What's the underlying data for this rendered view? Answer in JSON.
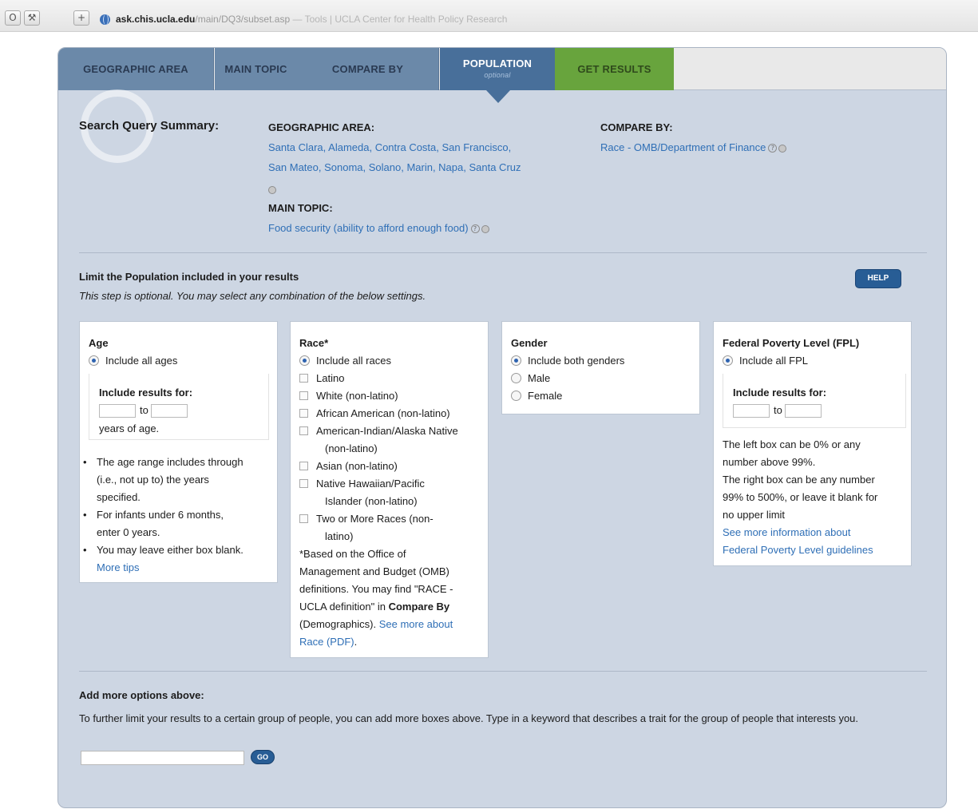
{
  "browser": {
    "url_host": "ask.chis.ucla.edu",
    "url_path": "/main/DQ3/subset.asp",
    "page_title": " — Tools | UCLA Center for Health Policy Research"
  },
  "tabs": {
    "geographic_area": "GEOGRAPHIC AREA",
    "main_topic": "MAIN TOPIC",
    "compare_by": "COMPARE BY",
    "population": "POPULATION",
    "population_sub": "optional",
    "get_results": "GET RESULTS"
  },
  "summary": {
    "label": "Search Query Summary:",
    "geo_heading": "GEOGRAPHIC AREA:",
    "geo_line1": "Santa Clara, Alameda, Contra Costa, San Francisco,",
    "geo_line2": "San Mateo, Sonoma, Solano, Marin, Napa, Santa Cruz",
    "main_heading": "MAIN TOPIC:",
    "main_value": "Food security (ability to afford enough food)",
    "compare_heading": "COMPARE BY:",
    "compare_value": "Race - OMB/Department of Finance"
  },
  "limit": {
    "title": "Limit the Population included in your results",
    "subtitle": "This step is optional. You may select any combination of the below settings.",
    "help_label": "HELP"
  },
  "age": {
    "heading": "Age",
    "include_all": "Include all ages",
    "include_results_for": "Include results for:",
    "to": "to",
    "years_of_age": "years of age.",
    "tip1_l1": "The age range includes through",
    "tip1_l2": "(i.e., not up to) the years",
    "tip1_l3": "specified.",
    "tip2_l1": "For infants under 6 months,",
    "tip2_l2": "enter 0 years.",
    "tip3_l1": "You may leave either box blank.",
    "more_tips": "More tips"
  },
  "race": {
    "heading": "Race*",
    "include_all": "Include all races",
    "latino": "Latino",
    "white": "White (non-latino)",
    "african_american": "African American (non-latino)",
    "american_indian_l1": "American-Indian/Alaska Native",
    "american_indian_l2": "(non-latino)",
    "asian": "Asian (non-latino)",
    "hawaiian_l1": "Native Hawaiian/Pacific",
    "hawaiian_l2": "Islander (non-latino)",
    "two_or_more_l1": "Two or More Races (non-",
    "two_or_more_l2": "latino)",
    "note_l1": "*Based on the Office of",
    "note_l2": "Management and Budget (OMB)",
    "note_l3": "definitions. You may find \"RACE -",
    "note_l4a": "UCLA definition\" in ",
    "note_l4b": "Compare By",
    "note_l5a": "(Demographics). ",
    "note_l5b": "See more about",
    "note_l6": "Race (PDF)",
    "note_l6_end": "."
  },
  "gender": {
    "heading": "Gender",
    "include_both": "Include both genders",
    "male": "Male",
    "female": "Female"
  },
  "fpl": {
    "heading": "Federal Poverty Level (FPL)",
    "include_all": "Include all FPL",
    "include_results_for": "Include results for:",
    "to": "to",
    "info_l1": "The left box can be 0% or any",
    "info_l2": "number above 99%.",
    "info_l3": "The right box can be any number",
    "info_l4": "99% to 500%, or leave it blank for",
    "info_l5": "no upper limit",
    "link_l1": "See more information about",
    "link_l2": "Federal Poverty Level guidelines"
  },
  "add_more": {
    "title": "Add more options above:",
    "description": "To further limit your results to a certain group of people, you can add more boxes above. Type in a keyword that describes a trait for the group of people that interests you.",
    "input_value": "",
    "go_label": "GO"
  },
  "colors": {
    "panel_bg": "#cdd6e3",
    "tab_inactive": "#6b89a9",
    "tab_active": "#486f9a",
    "tab_results": "#68a43d",
    "link": "#2f6fb6",
    "button": "#285d95"
  }
}
